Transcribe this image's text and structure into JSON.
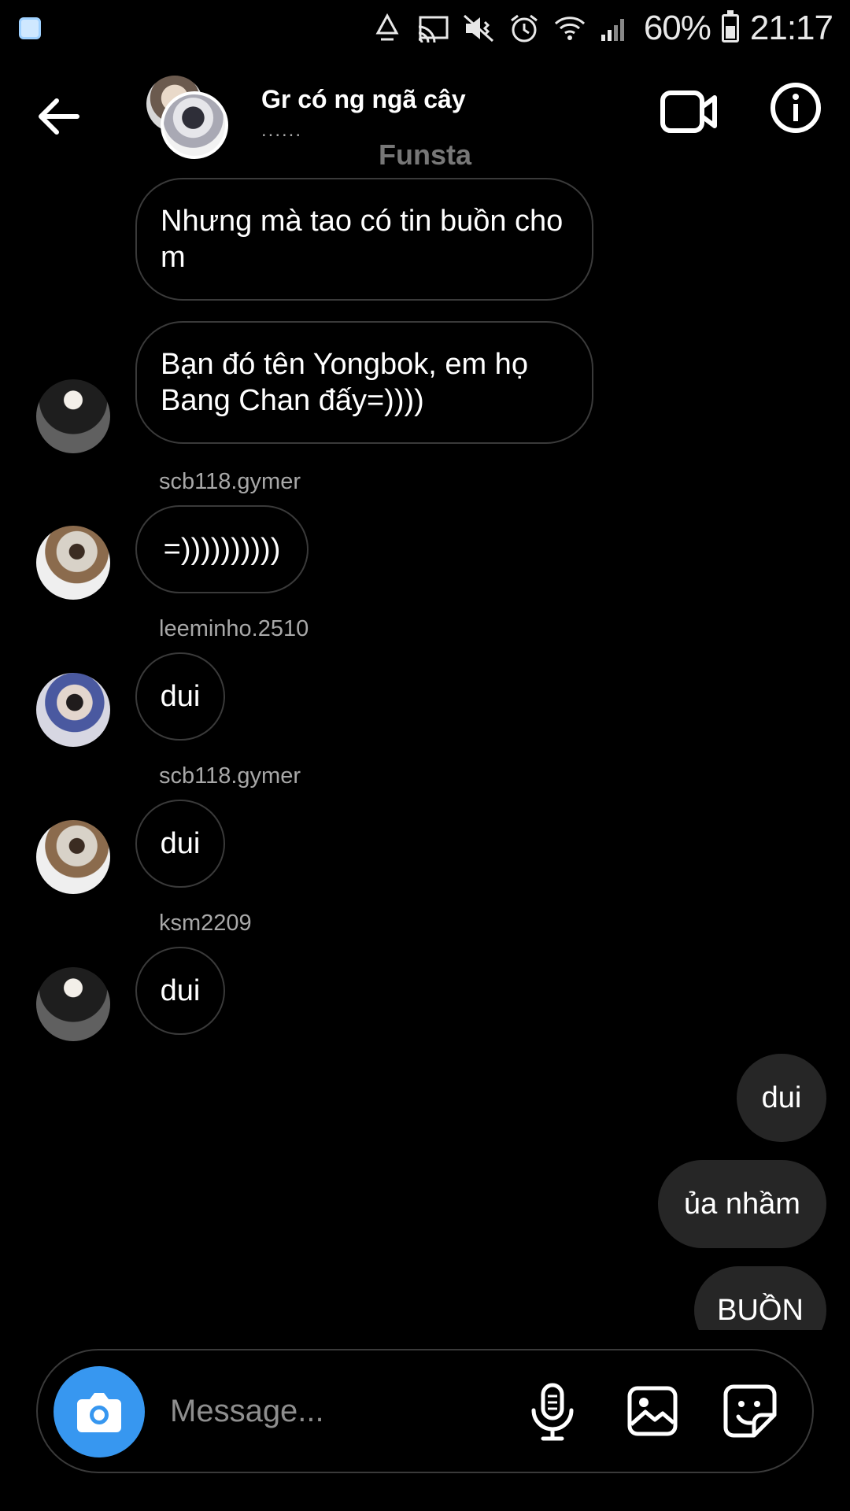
{
  "status_bar": {
    "battery": "60%",
    "time": "21:17",
    "icons": [
      "app-notification-icon",
      "recycle-icon",
      "cast-icon",
      "mute-vibrate-icon",
      "alarm-icon",
      "wifi-icon",
      "signal-icon",
      "battery-icon"
    ]
  },
  "header": {
    "title": "Gr có ng ngã cây",
    "subtitle": "......",
    "watermark": "Funsta",
    "icons": [
      "back-arrow-icon",
      "video-camera-icon",
      "info-icon"
    ]
  },
  "messages": [
    {
      "type": "incoming",
      "sender": "",
      "text": "Nhưng mà tao có tin buồn cho m"
    },
    {
      "type": "incoming",
      "sender": "",
      "text": "Bạn đó tên Yongbok, em họ Bang Chan đấy=))))",
      "avatar": "mask"
    },
    {
      "type": "incoming",
      "sender": "scb118.gymer",
      "text": "=))))))))))",
      "avatar": "book"
    },
    {
      "type": "incoming",
      "sender": "leeminho.2510",
      "text": "dui",
      "avatar": "phone"
    },
    {
      "type": "incoming",
      "sender": "scb118.gymer",
      "text": "dui",
      "avatar": "book"
    },
    {
      "type": "incoming",
      "sender": "ksm2209",
      "text": "dui",
      "avatar": "mask"
    },
    {
      "type": "outgoing",
      "text": "dui"
    },
    {
      "type": "outgoing",
      "text": "ủa nhầm"
    },
    {
      "type": "outgoing",
      "text": "BUỒN"
    }
  ],
  "composer": {
    "placeholder": "Message...",
    "icons": [
      "camera-icon",
      "microphone-icon",
      "gallery-icon",
      "sticker-icon"
    ]
  },
  "colors": {
    "background": "#000000",
    "camera_button": "#3797f0",
    "outgoing_bubble": "#262626",
    "bubble_border": "#3a3a3a",
    "sender_text": "#a8a8a8"
  }
}
